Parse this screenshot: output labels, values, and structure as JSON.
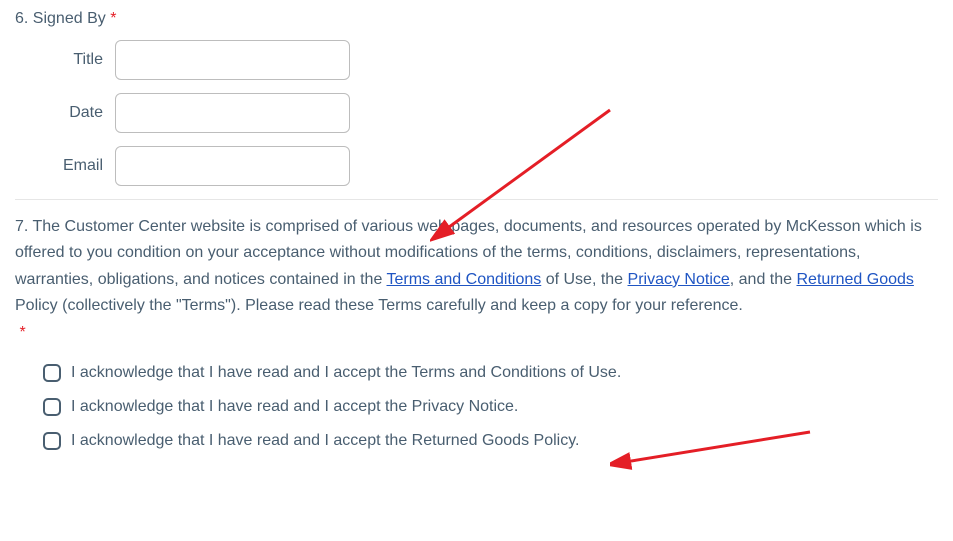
{
  "section6": {
    "heading_prefix": "6. ",
    "heading_text": "Signed By ",
    "required_mark": "*",
    "fields": {
      "title": {
        "label": "Title",
        "value": ""
      },
      "date": {
        "label": "Date",
        "value": ""
      },
      "email": {
        "label": "Email",
        "value": ""
      }
    }
  },
  "section7": {
    "heading_prefix": "7. ",
    "text_part1": "The Customer Center website is comprised of various web pages, documents, and resources operated by McKesson which is offered to you condition on your acceptance without modifications of the terms, conditions, disclaimers, representations, warranties, obligations, and notices contained in the ",
    "link1": "Terms and Conditions",
    "text_part2": " of Use, the ",
    "link2": "Privacy Notice",
    "text_part3": ", and the ",
    "link3": "Returned Goods",
    "text_part4": " Policy (collectively the \"Terms\").  Please read these Terms carefully and keep a copy for your reference.",
    "required_mark": "*",
    "checkboxes": {
      "terms": "I acknowledge that I have read and I accept the Terms and Conditions of Use.",
      "privacy": "I acknowledge that I have read and I accept the Privacy Notice.",
      "returned": "I acknowledge that I have read and I accept the Returned Goods Policy."
    }
  }
}
